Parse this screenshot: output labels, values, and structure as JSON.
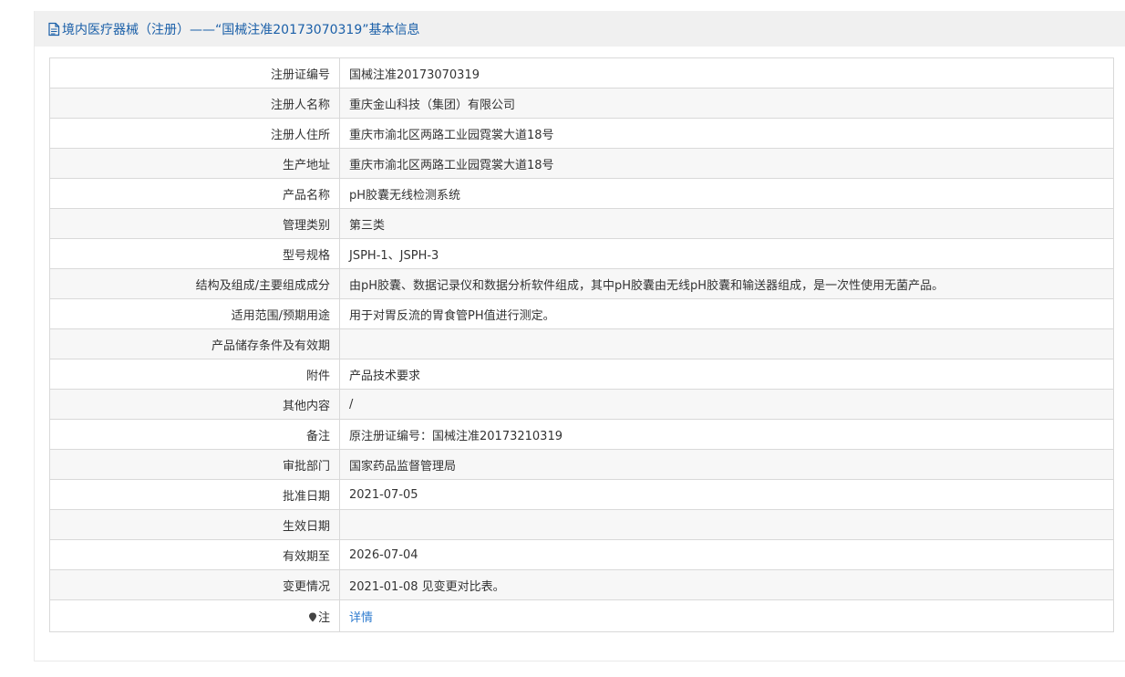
{
  "header": {
    "title": "境内医疗器械（注册）——“国械注准20173070319”基本信息",
    "icon": "document-icon"
  },
  "rows": [
    {
      "label": "注册证编号",
      "value": "国械注准20173070319"
    },
    {
      "label": "注册人名称",
      "value": "重庆金山科技（集团）有限公司"
    },
    {
      "label": "注册人住所",
      "value": "重庆市渝北区两路工业园霓裳大道18号"
    },
    {
      "label": "生产地址",
      "value": "重庆市渝北区两路工业园霓裳大道18号"
    },
    {
      "label": "产品名称",
      "value": "pH胶囊无线检测系统"
    },
    {
      "label": "管理类别",
      "value": "第三类"
    },
    {
      "label": "型号规格",
      "value": "JSPH-1、JSPH-3"
    },
    {
      "label": "结构及组成/主要组成成分",
      "value": "由pH胶囊、数据记录仪和数据分析软件组成，其中pH胶囊由无线pH胶囊和输送器组成，是一次性使用无菌产品。"
    },
    {
      "label": "适用范围/预期用途",
      "value": "用于对胃反流的胃食管PH值进行测定。"
    },
    {
      "label": "产品储存条件及有效期",
      "value": ""
    },
    {
      "label": "附件",
      "value": "产品技术要求"
    },
    {
      "label": "其他内容",
      "value": "/"
    },
    {
      "label": "备注",
      "value": "原注册证编号：国械注准20173210319"
    },
    {
      "label": "审批部门",
      "value": "国家药品监督管理局"
    },
    {
      "label": "批准日期",
      "value": "2021-07-05"
    },
    {
      "label": "生效日期",
      "value": ""
    },
    {
      "label": "有效期至",
      "value": "2026-07-04"
    },
    {
      "label": "变更情况",
      "value": "2021-01-08 见变更对比表。"
    }
  ],
  "note_row": {
    "label": "注",
    "icon": "pin-icon",
    "link_text": "详情"
  },
  "colors": {
    "title": "#1a5fa8",
    "link": "#2f7ccf",
    "header_bg": "#f0f0f0",
    "row_alt_bg": "#f7f7f7",
    "border": "#d9d9d9"
  }
}
